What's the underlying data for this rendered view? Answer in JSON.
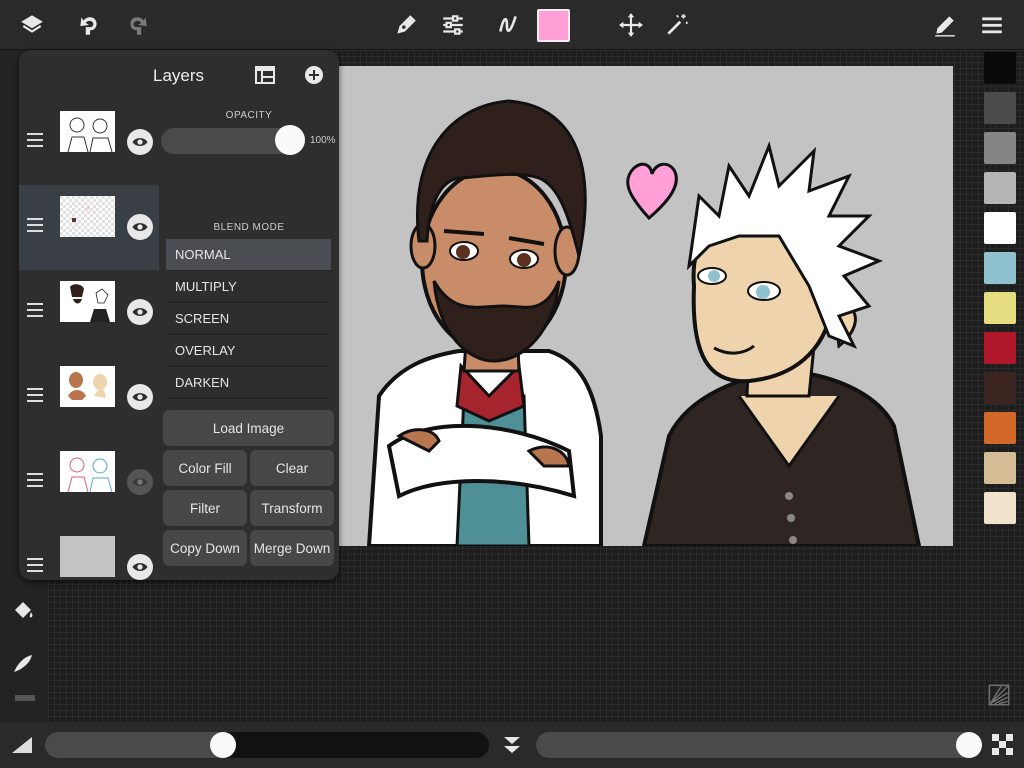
{
  "toolbar": {
    "current_color": "#ff9fd8",
    "icons": [
      "layers-icon",
      "undo-icon",
      "redo-icon",
      "pen-icon",
      "adjust-icon",
      "stroke-icon",
      "move-icon",
      "magic-wand-icon",
      "pencil-edit-icon",
      "menu-icon"
    ]
  },
  "layers_panel": {
    "title": "Layers",
    "opacity_label": "OPACITY",
    "opacity_value": "100%",
    "opacity_fraction": 1.0,
    "blend_label": "BLEND MODE",
    "blend_modes": [
      "NORMAL",
      "MULTIPLY",
      "SCREEN",
      "OVERLAY",
      "DARKEN"
    ],
    "selected_blend": "NORMAL",
    "buttons": {
      "load_image": "Load Image",
      "color_fill": "Color Fill",
      "clear": "Clear",
      "filter": "Filter",
      "transform": "Transform",
      "copy_down": "Copy Down",
      "merge_down": "Merge Down"
    },
    "layers": [
      {
        "visible": true,
        "selected": false
      },
      {
        "visible": true,
        "selected": true
      },
      {
        "visible": true,
        "selected": false
      },
      {
        "visible": true,
        "selected": false
      },
      {
        "visible": false,
        "selected": false
      },
      {
        "visible": true,
        "selected": false
      }
    ]
  },
  "palette": [
    "#0a0a0a",
    "#4b4b4b",
    "#858585",
    "#b5b5b5",
    "#ffffff",
    "#8fc1cf",
    "#e6dc80",
    "#b0162c",
    "#3c2420",
    "#d2692a",
    "#d4bd94",
    "#f0e3cc"
  ],
  "bottom": {
    "size_slider_fraction": 0.4,
    "opacity_slider_fraction": 1.0
  }
}
